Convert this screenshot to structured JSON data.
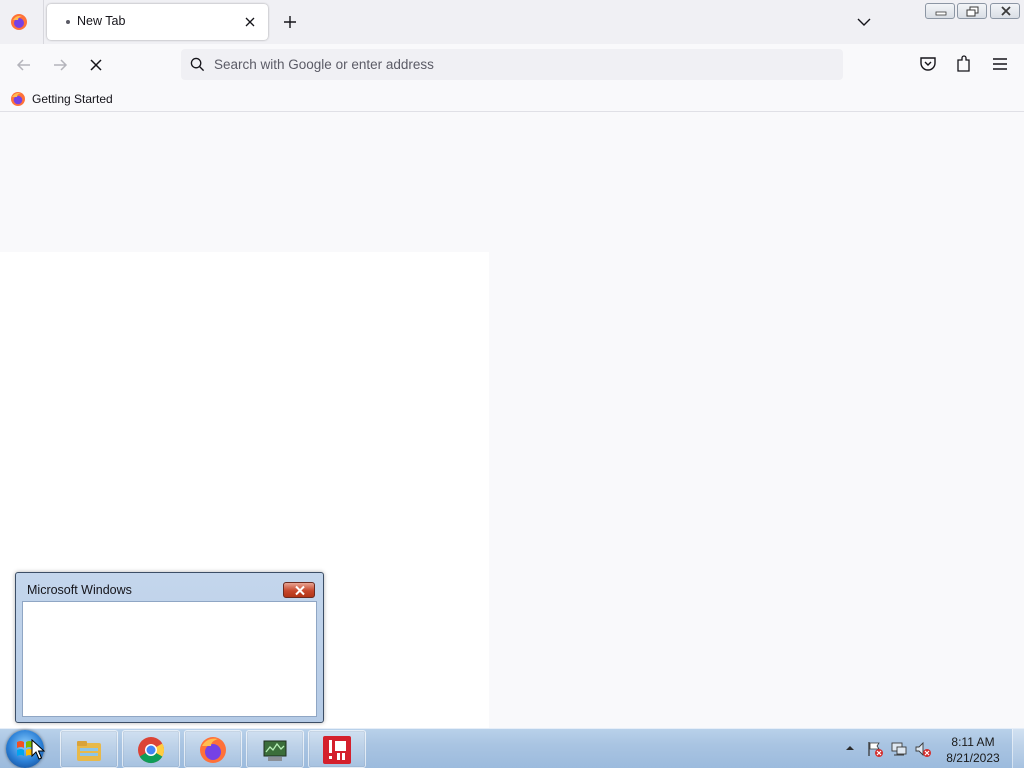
{
  "browser": {
    "tabs": [
      {
        "title": "New Tab",
        "loading": true
      }
    ],
    "urlbar": {
      "placeholder": "Search with Google or enter address",
      "value": ""
    },
    "bookmarks": [
      {
        "label": "Getting Started"
      }
    ],
    "nav": {
      "reload_state": "stop"
    }
  },
  "dialog": {
    "title": "Microsoft Windows",
    "body": ""
  },
  "taskbar": {
    "pinned": [
      "windows-explorer",
      "google-chrome",
      "firefox",
      "network-tool",
      "alert-app"
    ],
    "clock": {
      "time": "8:11 AM",
      "date": "8/21/2023"
    }
  },
  "colors": {
    "accent": "#0061e0",
    "tab_strip": "#f0f0f4",
    "page_bg": "#f9f9fb"
  }
}
